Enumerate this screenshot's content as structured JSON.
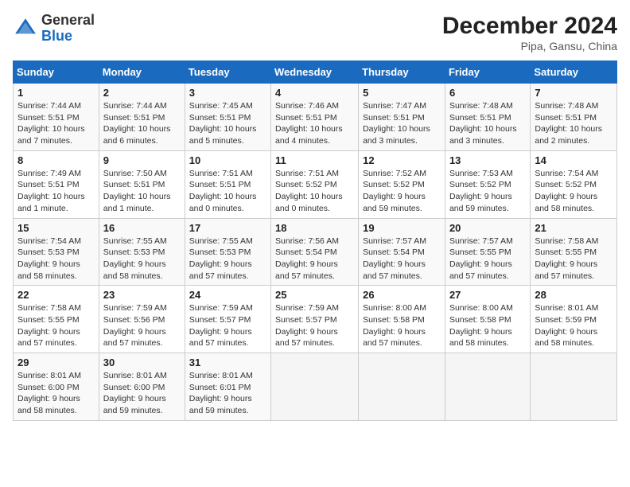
{
  "header": {
    "logo_line1": "General",
    "logo_line2": "Blue",
    "month": "December 2024",
    "location": "Pipa, Gansu, China"
  },
  "days_of_week": [
    "Sunday",
    "Monday",
    "Tuesday",
    "Wednesday",
    "Thursday",
    "Friday",
    "Saturday"
  ],
  "weeks": [
    [
      {
        "day": "1",
        "info": "Sunrise: 7:44 AM\nSunset: 5:51 PM\nDaylight: 10 hours\nand 7 minutes."
      },
      {
        "day": "2",
        "info": "Sunrise: 7:44 AM\nSunset: 5:51 PM\nDaylight: 10 hours\nand 6 minutes."
      },
      {
        "day": "3",
        "info": "Sunrise: 7:45 AM\nSunset: 5:51 PM\nDaylight: 10 hours\nand 5 minutes."
      },
      {
        "day": "4",
        "info": "Sunrise: 7:46 AM\nSunset: 5:51 PM\nDaylight: 10 hours\nand 4 minutes."
      },
      {
        "day": "5",
        "info": "Sunrise: 7:47 AM\nSunset: 5:51 PM\nDaylight: 10 hours\nand 3 minutes."
      },
      {
        "day": "6",
        "info": "Sunrise: 7:48 AM\nSunset: 5:51 PM\nDaylight: 10 hours\nand 3 minutes."
      },
      {
        "day": "7",
        "info": "Sunrise: 7:48 AM\nSunset: 5:51 PM\nDaylight: 10 hours\nand 2 minutes."
      }
    ],
    [
      {
        "day": "8",
        "info": "Sunrise: 7:49 AM\nSunset: 5:51 PM\nDaylight: 10 hours\nand 1 minute."
      },
      {
        "day": "9",
        "info": "Sunrise: 7:50 AM\nSunset: 5:51 PM\nDaylight: 10 hours\nand 1 minute."
      },
      {
        "day": "10",
        "info": "Sunrise: 7:51 AM\nSunset: 5:51 PM\nDaylight: 10 hours\nand 0 minutes."
      },
      {
        "day": "11",
        "info": "Sunrise: 7:51 AM\nSunset: 5:52 PM\nDaylight: 10 hours\nand 0 minutes."
      },
      {
        "day": "12",
        "info": "Sunrise: 7:52 AM\nSunset: 5:52 PM\nDaylight: 9 hours\nand 59 minutes."
      },
      {
        "day": "13",
        "info": "Sunrise: 7:53 AM\nSunset: 5:52 PM\nDaylight: 9 hours\nand 59 minutes."
      },
      {
        "day": "14",
        "info": "Sunrise: 7:54 AM\nSunset: 5:52 PM\nDaylight: 9 hours\nand 58 minutes."
      }
    ],
    [
      {
        "day": "15",
        "info": "Sunrise: 7:54 AM\nSunset: 5:53 PM\nDaylight: 9 hours\nand 58 minutes."
      },
      {
        "day": "16",
        "info": "Sunrise: 7:55 AM\nSunset: 5:53 PM\nDaylight: 9 hours\nand 58 minutes."
      },
      {
        "day": "17",
        "info": "Sunrise: 7:55 AM\nSunset: 5:53 PM\nDaylight: 9 hours\nand 57 minutes."
      },
      {
        "day": "18",
        "info": "Sunrise: 7:56 AM\nSunset: 5:54 PM\nDaylight: 9 hours\nand 57 minutes."
      },
      {
        "day": "19",
        "info": "Sunrise: 7:57 AM\nSunset: 5:54 PM\nDaylight: 9 hours\nand 57 minutes."
      },
      {
        "day": "20",
        "info": "Sunrise: 7:57 AM\nSunset: 5:55 PM\nDaylight: 9 hours\nand 57 minutes."
      },
      {
        "day": "21",
        "info": "Sunrise: 7:58 AM\nSunset: 5:55 PM\nDaylight: 9 hours\nand 57 minutes."
      }
    ],
    [
      {
        "day": "22",
        "info": "Sunrise: 7:58 AM\nSunset: 5:55 PM\nDaylight: 9 hours\nand 57 minutes."
      },
      {
        "day": "23",
        "info": "Sunrise: 7:59 AM\nSunset: 5:56 PM\nDaylight: 9 hours\nand 57 minutes."
      },
      {
        "day": "24",
        "info": "Sunrise: 7:59 AM\nSunset: 5:57 PM\nDaylight: 9 hours\nand 57 minutes."
      },
      {
        "day": "25",
        "info": "Sunrise: 7:59 AM\nSunset: 5:57 PM\nDaylight: 9 hours\nand 57 minutes."
      },
      {
        "day": "26",
        "info": "Sunrise: 8:00 AM\nSunset: 5:58 PM\nDaylight: 9 hours\nand 57 minutes."
      },
      {
        "day": "27",
        "info": "Sunrise: 8:00 AM\nSunset: 5:58 PM\nDaylight: 9 hours\nand 58 minutes."
      },
      {
        "day": "28",
        "info": "Sunrise: 8:01 AM\nSunset: 5:59 PM\nDaylight: 9 hours\nand 58 minutes."
      }
    ],
    [
      {
        "day": "29",
        "info": "Sunrise: 8:01 AM\nSunset: 6:00 PM\nDaylight: 9 hours\nand 58 minutes."
      },
      {
        "day": "30",
        "info": "Sunrise: 8:01 AM\nSunset: 6:00 PM\nDaylight: 9 hours\nand 59 minutes."
      },
      {
        "day": "31",
        "info": "Sunrise: 8:01 AM\nSunset: 6:01 PM\nDaylight: 9 hours\nand 59 minutes."
      },
      {
        "day": "",
        "info": ""
      },
      {
        "day": "",
        "info": ""
      },
      {
        "day": "",
        "info": ""
      },
      {
        "day": "",
        "info": ""
      }
    ]
  ]
}
